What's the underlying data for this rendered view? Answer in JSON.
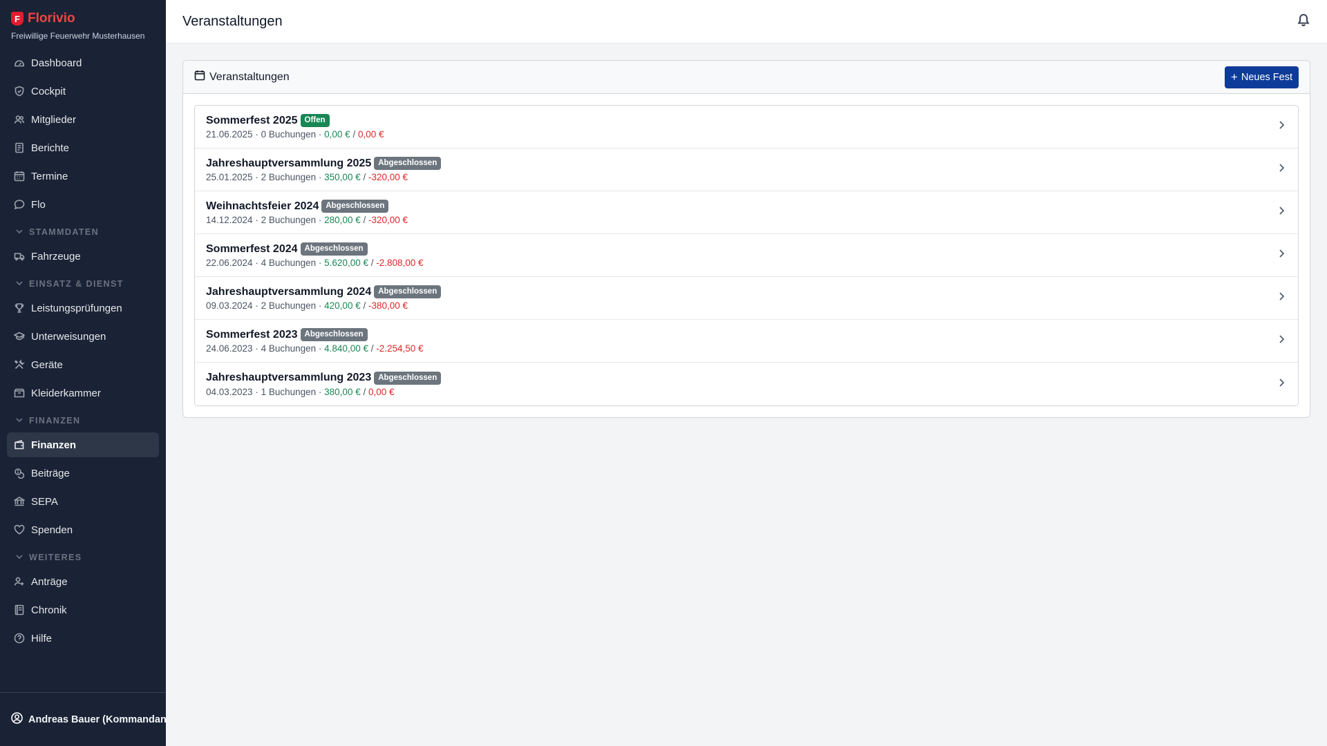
{
  "brand": {
    "name": "Florivio",
    "logo_letter": "F",
    "subtitle": "Freiwillige Feuerwehr Musterhausen"
  },
  "nav": {
    "main": [
      {
        "label": "Dashboard",
        "icon": "dashboard-icon"
      },
      {
        "label": "Cockpit",
        "icon": "shield-icon"
      },
      {
        "label": "Mitglieder",
        "icon": "users-icon"
      },
      {
        "label": "Berichte",
        "icon": "document-icon"
      },
      {
        "label": "Termine",
        "icon": "calendar-icon"
      },
      {
        "label": "Flo",
        "icon": "chat-icon"
      }
    ],
    "sections": [
      {
        "label": "STAMMDATEN",
        "items": [
          {
            "label": "Fahrzeuge",
            "icon": "truck-icon"
          }
        ]
      },
      {
        "label": "EINSATZ & DIENST",
        "items": [
          {
            "label": "Leistungsprüfungen",
            "icon": "trophy-icon"
          },
          {
            "label": "Unterweisungen",
            "icon": "graduation-icon"
          },
          {
            "label": "Geräte",
            "icon": "tools-icon"
          },
          {
            "label": "Kleiderkammer",
            "icon": "box-icon"
          }
        ]
      },
      {
        "label": "FINANZEN",
        "items": [
          {
            "label": "Finanzen",
            "icon": "wallet-icon",
            "active": true
          },
          {
            "label": "Beiträge",
            "icon": "coins-icon"
          },
          {
            "label": "SEPA",
            "icon": "bank-icon"
          },
          {
            "label": "Spenden",
            "icon": "heart-icon"
          }
        ]
      },
      {
        "label": "WEITERES",
        "items": [
          {
            "label": "Anträge",
            "icon": "user-plus-icon"
          },
          {
            "label": "Chronik",
            "icon": "book-icon"
          },
          {
            "label": "Hilfe",
            "icon": "help-icon"
          }
        ]
      }
    ]
  },
  "user": {
    "name": "Andreas Bauer (Kommandant)"
  },
  "header": {
    "title": "Veranstaltungen"
  },
  "card": {
    "title": "Veranstaltungen",
    "new_button": "Neues Fest"
  },
  "events": [
    {
      "name": "Sommerfest 2025",
      "status": "Offen",
      "status_color": "#198754",
      "date": "21.06.2025",
      "bookings": "0 Buchungen",
      "income": "0,00 €",
      "expense": "0,00 €"
    },
    {
      "name": "Jahreshauptversammlung 2025",
      "status": "Abgeschlossen",
      "status_color": "#6c757d",
      "date": "25.01.2025",
      "bookings": "2 Buchungen",
      "income": "350,00 €",
      "expense": "-320,00 €"
    },
    {
      "name": "Weihnachtsfeier 2024",
      "status": "Abgeschlossen",
      "status_color": "#6c757d",
      "date": "14.12.2024",
      "bookings": "2 Buchungen",
      "income": "280,00 €",
      "expense": "-320,00 €"
    },
    {
      "name": "Sommerfest 2024",
      "status": "Abgeschlossen",
      "status_color": "#6c757d",
      "date": "22.06.2024",
      "bookings": "4 Buchungen",
      "income": "5.620,00 €",
      "expense": "-2.808,00 €"
    },
    {
      "name": "Jahreshauptversammlung 2024",
      "status": "Abgeschlossen",
      "status_color": "#6c757d",
      "date": "09.03.2024",
      "bookings": "2 Buchungen",
      "income": "420,00 €",
      "expense": "-380,00 €"
    },
    {
      "name": "Sommerfest 2023",
      "status": "Abgeschlossen",
      "status_color": "#6c757d",
      "date": "24.06.2023",
      "bookings": "4 Buchungen",
      "income": "4.840,00 €",
      "expense": "-2.254,50 €"
    },
    {
      "name": "Jahreshauptversammlung 2023",
      "status": "Abgeschlossen",
      "status_color": "#6c757d",
      "date": "04.03.2023",
      "bookings": "1 Buchungen",
      "income": "380,00 €",
      "expense": "0,00 €"
    }
  ]
}
